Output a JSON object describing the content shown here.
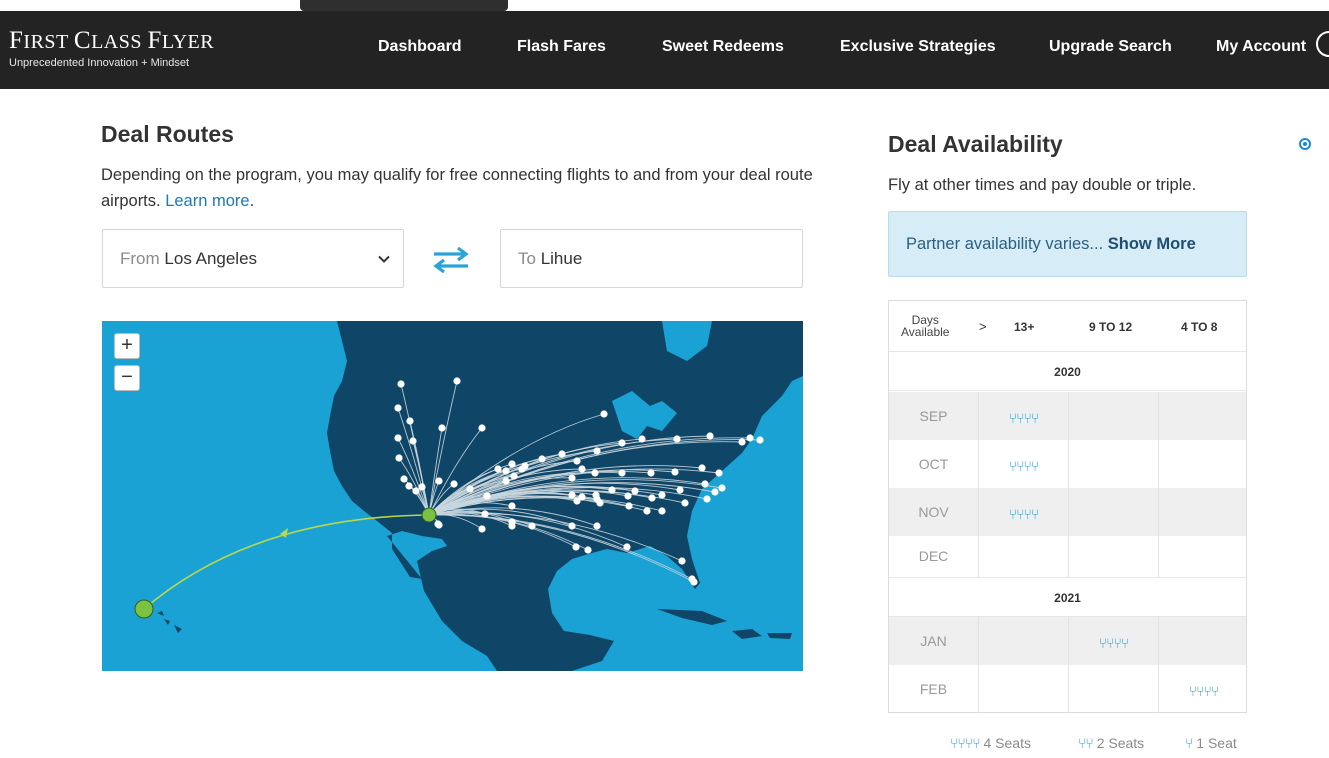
{
  "header": {
    "brand_title_F": "F",
    "brand_title_rest1": "IRST ",
    "brand_title_C": "C",
    "brand_title_rest2": "LASS ",
    "brand_title_F2": "F",
    "brand_title_rest3": "LYER",
    "brand_subtitle": "Unprecedented Innovation + Mindset",
    "nav": [
      "Dashboard",
      "Flash Fares",
      "Sweet Redeems",
      "Exclusive Strategies",
      "Upgrade Search",
      "My Account"
    ]
  },
  "deal_routes": {
    "title": "Deal Routes",
    "description": "Depending on the program, you may qualify for free connecting flights to and from your deal route airports.",
    "learn_more": "Learn more",
    "period": ".",
    "from_prefix": "From",
    "from_value": "Los Angeles",
    "to_prefix": "To",
    "to_value": "Lihue",
    "zoom_in": "+",
    "zoom_out": "−"
  },
  "deal_availability": {
    "title": "Deal Availability",
    "subtitle": "Fly at other times and pay double or triple.",
    "partner_text": "Partner availability varies...",
    "show_more": "Show More",
    "days_label_1": "Days",
    "days_label_2": "Available",
    "arrow": ">",
    "columns": [
      "13+",
      "9 TO 12",
      "4 TO 8"
    ],
    "years": [
      "2020",
      "2021"
    ],
    "rows": [
      {
        "month": "SEP",
        "col": 0,
        "seats": 4
      },
      {
        "month": "OCT",
        "col": 0,
        "seats": 4
      },
      {
        "month": "NOV",
        "col": 0,
        "seats": 4
      },
      {
        "month": "DEC",
        "col": -1,
        "seats": 0
      },
      {
        "month": "JAN",
        "col": 1,
        "seats": 4
      },
      {
        "month": "FEB",
        "col": 2,
        "seats": 4
      }
    ],
    "legend": [
      "4 Seats",
      "2 Seats",
      "1 Seat"
    ]
  },
  "colors": {
    "header_bg": "#232323",
    "ocean": "#1aa2d4",
    "land": "#0f4667",
    "route_lines": "#c9d6de",
    "origin_marker": "#7cc142",
    "seat_icon": "#29a3d8",
    "partner_bg": "#d6ecf6"
  },
  "icons": {
    "swap": "swap-arrows-icon",
    "dropdown": "chevron-down-icon",
    "seat": "seat-icon",
    "account": "account-icon"
  }
}
